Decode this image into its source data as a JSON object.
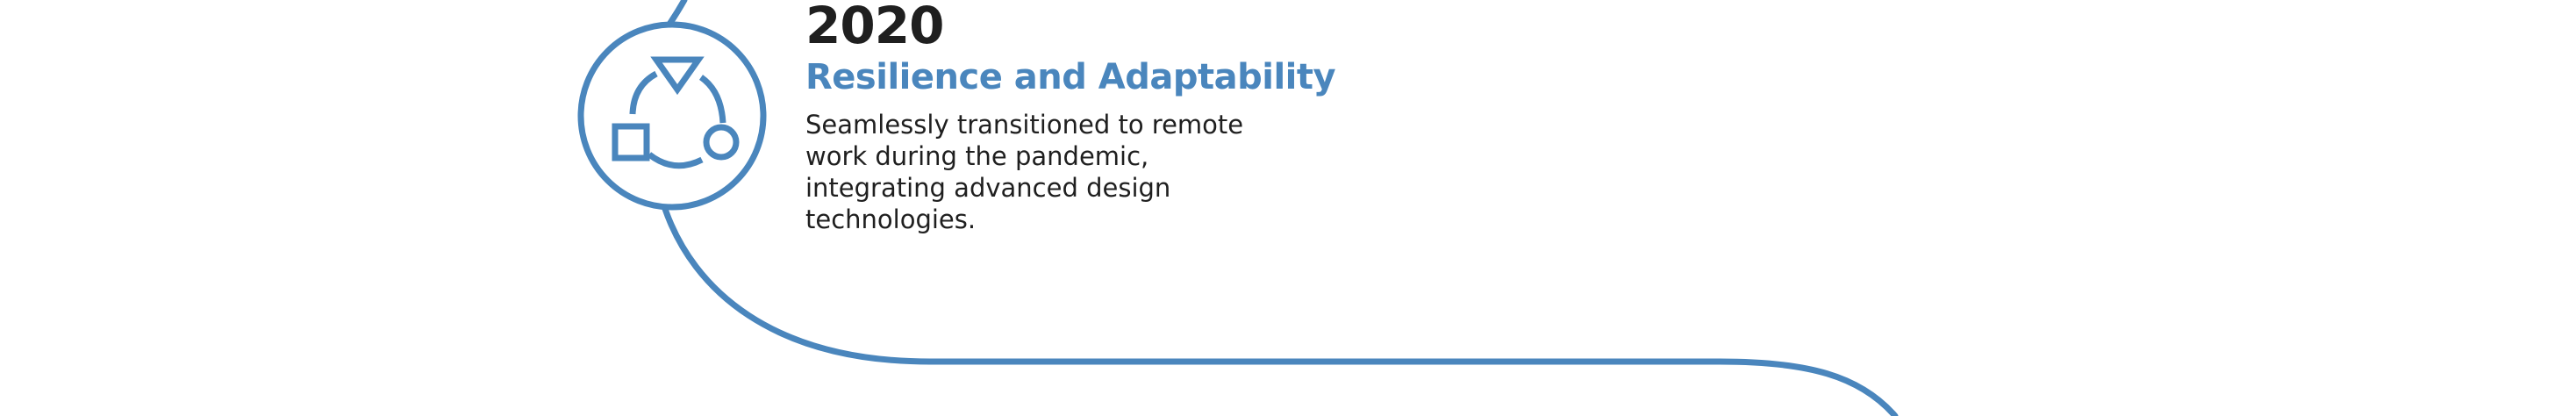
{
  "colors": {
    "accent": "#4a86bd",
    "text": "#1f1f1f",
    "background": "#ffffff"
  },
  "milestone": {
    "year": "2020",
    "title": "Resilience and Adaptability",
    "description": "Seamlessly transitioned to remote work during the pandemic, integrating advanced design technologies.",
    "icon": "adaptability-cycle-icon"
  }
}
